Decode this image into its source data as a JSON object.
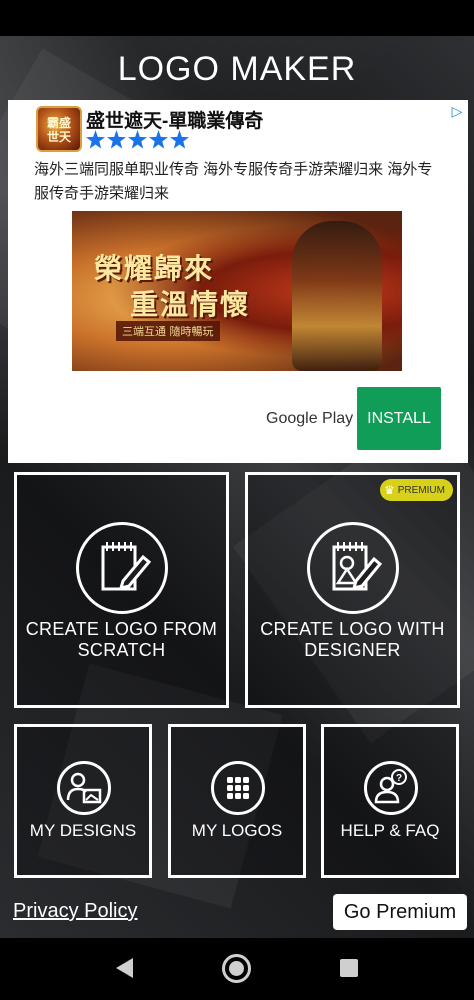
{
  "app": {
    "title": "LOGO MAKER"
  },
  "ad": {
    "title": "盛世遮天-單職業傳奇",
    "logo_text": "霸盛\n世天",
    "rating_stars": 5,
    "description": "海外三端同服单职业传奇 海外专服传奇手游荣耀归来 海外专服传奇手游荣耀归来",
    "image_line1": "榮耀歸來",
    "image_line2": "重溫情懷",
    "image_sub": "三端互通 隨時暢玩",
    "store": "Google Play",
    "install": "INSTALL",
    "badge_icon": "adchoices-icon"
  },
  "tiles": {
    "scratch": {
      "label": "CREATE LOGO FROM SCRATCH",
      "icon": "notepad-pencil-icon"
    },
    "designer": {
      "label": "CREATE LOGO WITH DESIGNER",
      "icon": "notepad-shape-icon",
      "badge": "PREMIUM"
    },
    "my_designs": {
      "label": "MY DESIGNS",
      "icon": "person-image-icon"
    },
    "my_logos": {
      "label": "MY LOGOS",
      "icon": "grid-dots-icon"
    },
    "help": {
      "label": "HELP & FAQ",
      "icon": "person-question-icon"
    }
  },
  "footer": {
    "privacy": "Privacy Policy",
    "go_premium": "Go Premium"
  },
  "colors": {
    "install_button": "#0f9d58",
    "star": "#1a73e8",
    "premium_badge": "#d7d11b"
  }
}
